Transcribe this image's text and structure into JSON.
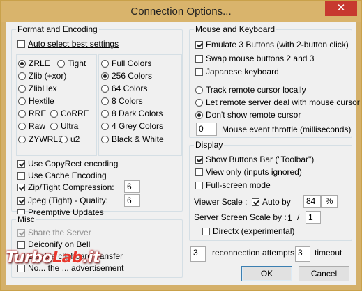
{
  "window": {
    "title": "Connection Options...",
    "close_glyph": "✕"
  },
  "format_group": {
    "label": "Format and Encoding",
    "auto_select": {
      "label": "Auto select best settings",
      "checked": false
    },
    "encodings": [
      {
        "label": "ZRLE",
        "checked": true
      },
      {
        "label": "Tight",
        "checked": false
      },
      {
        "label": "Zlib (+xor)",
        "checked": false
      },
      {
        "label": "ZlibHex",
        "checked": false
      },
      {
        "label": "Hextile",
        "checked": false
      },
      {
        "label": "RRE",
        "checked": false
      },
      {
        "label": "CoRRE",
        "checked": false
      },
      {
        "label": "Raw",
        "checked": false
      },
      {
        "label": "Ultra",
        "checked": false
      },
      {
        "label": "ZYWRLE",
        "checked": false
      },
      {
        "label": "u2",
        "checked": false
      }
    ],
    "colors": [
      {
        "label": "Full Colors",
        "checked": false
      },
      {
        "label": "256 Colors",
        "checked": true
      },
      {
        "label": "64 Colors",
        "checked": false
      },
      {
        "label": "8 Colors",
        "checked": false
      },
      {
        "label": "8 Dark Colors",
        "checked": false
      },
      {
        "label": "4 Grey Colors",
        "checked": false
      },
      {
        "label": "Black & White",
        "checked": false
      }
    ],
    "copyrect": {
      "label": "Use CopyRect encoding",
      "checked": true
    },
    "cache": {
      "label": "Use Cache Encoding",
      "checked": false
    },
    "zip": {
      "label": "Zip/Tight Compression:",
      "checked": true,
      "value": "6"
    },
    "jpeg": {
      "label": "Jpeg (Tight) - Quality:",
      "checked": true,
      "value": "6"
    },
    "preemptive": {
      "label": "Preemptive Updates",
      "checked": false
    }
  },
  "misc_group": {
    "label": "Misc",
    "share": {
      "label": "Share the Server",
      "checked": true
    },
    "deiconify": {
      "label": "Deiconify on Bell",
      "checked": false
    },
    "clipboard": {
      "label": "Disable clipboard transfer",
      "checked": false
    },
    "advert": {
      "label": "No... the ... advertisement",
      "checked": false
    }
  },
  "mouse_group": {
    "label": "Mouse and Keyboard",
    "emulate3": {
      "label": "Emulate 3 Buttons (with 2-button click)",
      "checked": true
    },
    "swap": {
      "label": "Swap mouse buttons 2 and 3",
      "checked": false
    },
    "japanese": {
      "label": "Japanese keyboard",
      "checked": false
    },
    "cursor_opts": [
      {
        "label": "Track remote cursor locally",
        "checked": false
      },
      {
        "label": "Let remote server deal with mouse cursor",
        "checked": false
      },
      {
        "label": "Don't show remote cursor",
        "checked": true
      }
    ],
    "throttle": {
      "value": "0",
      "label": "Mouse event throttle (milliseconds)"
    }
  },
  "display_group": {
    "label": "Display",
    "toolbar": {
      "label": "Show Buttons Bar (\"Toolbar\")",
      "checked": true
    },
    "viewonly": {
      "label": "View only (inputs ignored)",
      "checked": false
    },
    "fullscreen": {
      "label": "Full-screen mode",
      "checked": false
    },
    "viewer_scale": {
      "label": "Viewer Scale :",
      "auto_label": "Auto by",
      "auto_checked": true,
      "value": "84",
      "unit": "%"
    },
    "server_scale": {
      "label": "Server Screen Scale by :",
      "numerator": "1",
      "sep": "/",
      "value": "1"
    },
    "directx": {
      "label": "Directx (experimental)",
      "checked": false
    }
  },
  "reconnect": {
    "value": "3",
    "label": "reconnection attempts",
    "timeout_value": "3",
    "timeout_label": "timeout"
  },
  "buttons": {
    "ok": "OK",
    "cancel": "Cancel"
  },
  "watermark": {
    "prefix": "Turbo",
    "accent": "Lab",
    "suffix": ".it"
  }
}
